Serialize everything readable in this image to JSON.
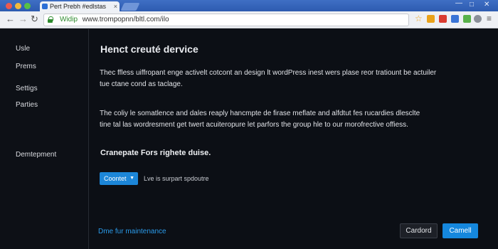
{
  "browser": {
    "tab_title": "Pert Prebh #edlstas",
    "tab_close": "×",
    "url_secure_label": "Widip",
    "url": "www.trompopnn/bltl.com/ilo",
    "icons": {
      "back": "back-arrow-icon",
      "forward": "forward-arrow-icon",
      "reload": "reload-icon",
      "lock": "lock-icon",
      "bookmark": "star-icon",
      "menu": "hamburger-menu-icon"
    },
    "colors": {
      "tabbar": "#3f6fc4",
      "secure": "#2e8b2e"
    }
  },
  "sidebar": {
    "items": [
      {
        "label": "Usle"
      },
      {
        "label": "Prems"
      },
      {
        "label": "Settigs"
      },
      {
        "label": "Parties"
      },
      {
        "label": "Demtepment"
      }
    ]
  },
  "main": {
    "title": "Henct creuté dervice",
    "paragraph1_line1": "Thec ffless uiffropant enge activelt cotcont an design lt wordPress inest wers plase reor tratiount be actuiler",
    "paragraph1_line2": "tue ctane cond as taclage.",
    "paragraph2_line1": "The coliy le somatlence and dales reaply hancmpte de firase meflate and alfdtut fes rucardies dlesclte",
    "paragraph2_line2": "tine tal las wordresment get twert acuiteropure let parfors the group hle to our morofrective offiess.",
    "sub_heading": "Cranepate Fors righete duise.",
    "select_button_label": "Coontet",
    "select_hint": "Lve is surpart spdoutre",
    "footer_link": "Dme fur maintenance",
    "secondary_button_label": "Cardord",
    "primary_button_label": "Camell"
  },
  "theme": {
    "background": "#0c0f15",
    "accent": "#1587dd",
    "link": "#2b9bea"
  }
}
